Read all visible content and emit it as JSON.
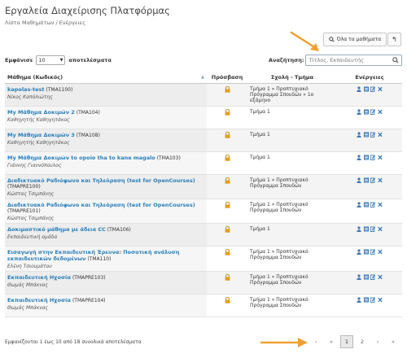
{
  "header": {
    "title": "Εργαλεία Διαχείρισης Πλατφόρμας",
    "breadcrumb": "Λίστα Μαθημάτων / Ενέργειες"
  },
  "toolbar": {
    "all_courses_label": "Όλα τα μαθήματα",
    "back_symbol": "↰"
  },
  "length": {
    "prefix": "Εμφάνισε",
    "value": "10",
    "suffix": "αποτελέσματα"
  },
  "search": {
    "label": "Αναζήτηση:",
    "placeholder": "Τίτλος, Εκπαιδευτής"
  },
  "columns": {
    "course": "Μάθημα (Κωδικός)",
    "access": "Πρόσβαση",
    "school": "Σχολή - Τμήμα",
    "actions": "Ενέργειες"
  },
  "rows": [
    {
      "title": "kapolas-test",
      "code": "(TMA1100)",
      "teacher": "Νίκος Καπόλιώτης",
      "school": "Τμήμα 1 » Προπτυχιακό Πρόγραμμα Σπουδών » 1ο εξάμηνο"
    },
    {
      "title": "My Μάθημα Δοκιμών 2",
      "code": "(TMA104)",
      "teacher": "Καθηγητής Καθηγητάκος",
      "school": "Τμήμα 1"
    },
    {
      "title": "My Μάθημα Δοκιμών 3",
      "code": "(TMA108)",
      "teacher": "Καθηγητής Καθηγητάκος",
      "school": "Τμήμα 1"
    },
    {
      "title": "My Μάθημα Δοκιμών to opoio tha to kane magalo",
      "code": "(TMA103)",
      "teacher": "Γιάννης Γιαννόπουλος",
      "school": "Τμήμα 1"
    },
    {
      "title": "Διαδικτυακό Ραδιόφωνο και Τηλεόραση (test for OpenCourses)",
      "code": "(TMAPRE100)",
      "teacher": "Κώστας Τσιμπάνης",
      "school": "Τμήμα 1 » Προπτυχιακό Πρόγραμμα Σπουδών"
    },
    {
      "title": "Διαδικτυακό Ραδιόφωνο και Τηλεόραση (test for OpenCourses)",
      "code": "(TMAPRE101)",
      "teacher": "Κώστας Τσιμπάνης",
      "school": "Τμήμα 1 » Προπτυχιακό Πρόγραμμα Σπουδών"
    },
    {
      "title": "Δοκιμαστικό μάθημα με άδεια CC",
      "code": "(TMA106)",
      "teacher": "Εκπαιδευτική ομάδα",
      "school": "Τμήμα 1"
    },
    {
      "title": "Εισαγωγή στην Εκπαιδευτική Έρευνα: Ποσοτική ανάλυση εκπαιδευτικών δεδομένων",
      "code": "(TMA110)",
      "teacher": "Ελένη Τσιουμάτου",
      "school": "Τμήμα 1 » Προπτυχιακό Πρόγραμμα Σπουδών"
    },
    {
      "title": "Εκπαιδευτική Ηχοσία",
      "code": "(TMAPRE103)",
      "teacher": "Θωμάς Μπάκνας",
      "school": "Τμήμα 1 » Προπτυχιακό Πρόγραμμα Σπουδών"
    },
    {
      "title": "Εκπαιδευτική Ηχοσία",
      "code": "(TMAPRE104)",
      "teacher": "Θωμάς Μπάκνας",
      "school": "Τμήμα 1 » Προπτυχιακό Πρόγραμμα Σπουδών"
    }
  ],
  "footer": {
    "info": "Εμφανίζονται 1 έως 10 από 18 συνολικά αποτελέσματα",
    "pages": {
      "prev": "‹",
      "dots": "«",
      "current": "1",
      "next_page": "2",
      "next": "›",
      "last": "»"
    }
  },
  "colors": {
    "link": "#2a7fbb",
    "arrow": "#f0a030",
    "lock": "#e0a020"
  }
}
